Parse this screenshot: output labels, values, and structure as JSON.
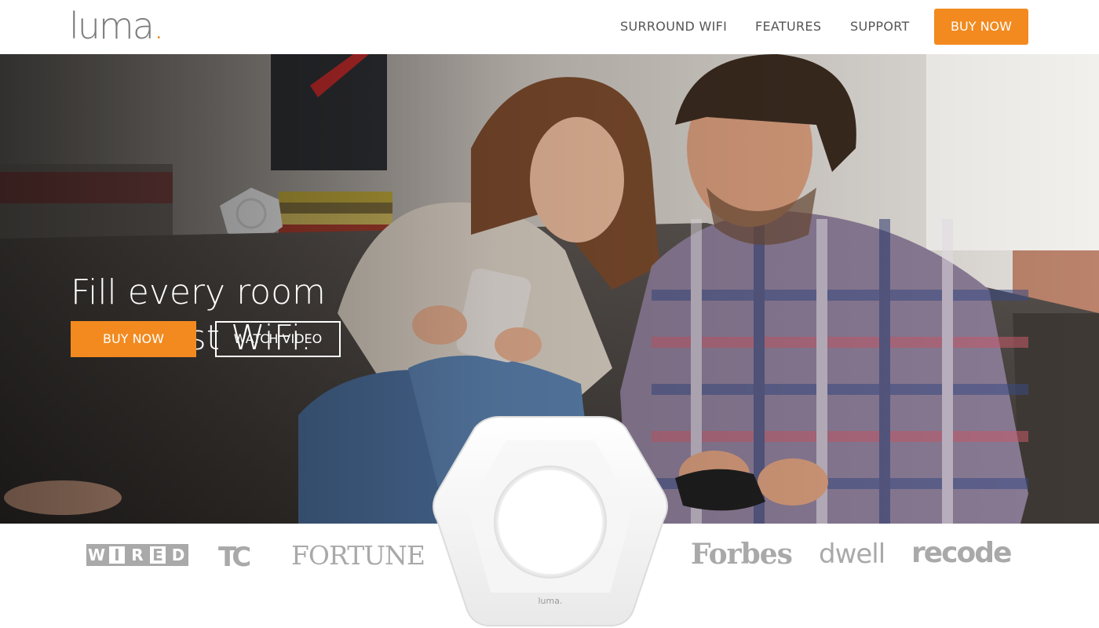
{
  "header": {
    "logo_text": "luma",
    "logo_dot": ".",
    "nav": [
      {
        "label": "SURROUND WIFI"
      },
      {
        "label": "FEATURES"
      },
      {
        "label": "SUPPORT"
      }
    ],
    "buy_label": "BUY NOW"
  },
  "hero": {
    "headline_line1": "Fill every room",
    "headline_line2": "with fast WiFi.",
    "buy_label": "BUY NOW",
    "video_label": "WATCH VIDEO"
  },
  "press": {
    "wired": [
      "W",
      "I",
      "R",
      "E",
      "D"
    ],
    "techcrunch": "TC",
    "fortune": "FORTUNE",
    "forbes": "Forbes",
    "dwell": "dwell",
    "recode": "recode"
  },
  "device": {
    "label": "luma."
  },
  "colors": {
    "accent": "#f28a1f",
    "nav_text": "#555555",
    "press_gray": "#a9a9a9"
  }
}
